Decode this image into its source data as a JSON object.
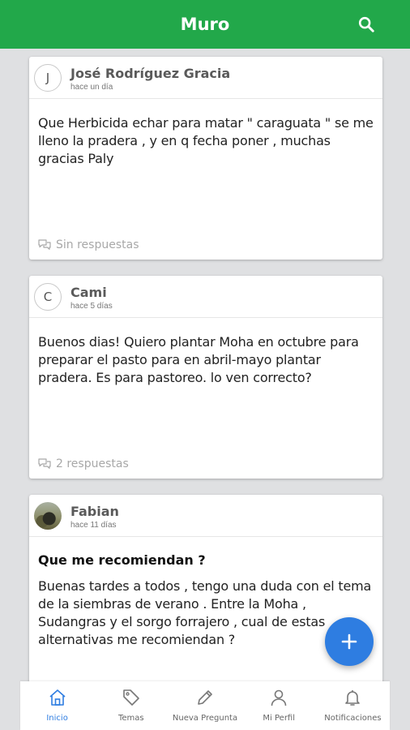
{
  "app_bar": {
    "title": "Muro",
    "search_icon": "search-icon"
  },
  "posts": [
    {
      "avatar_letter": "J",
      "author": "José Rodríguez Gracia",
      "time": "hace un día",
      "title": "",
      "text": "Que Herbicida echar para matar  \" caraguata \" se me lleno la pradera , y en q fecha poner , muchas gracias Paly",
      "replies": "Sin respuestas"
    },
    {
      "avatar_letter": "C",
      "author": "Cami",
      "time": "hace 5 días",
      "title": "",
      "text": "Buenos dias! Quiero plantar Moha en octubre para preparar el pasto para en abril-mayo plantar pradera. Es para pastoreo. lo ven correcto?",
      "replies": "2 respuestas"
    },
    {
      "avatar_letter": "",
      "author": "Fabian",
      "time": "hace 11 días",
      "title": "Que me recomiendan ?",
      "text": "Buenas tardes a todos , tengo una duda con el tema de la siembras de verano . Entre la Moha , Sudangras y el sorgo forrajero , cual de estas alternativas me recomiendan ?",
      "replies": ""
    }
  ],
  "fab": {
    "icon": "plus-icon"
  },
  "bottom_nav": [
    {
      "label": "Inicio",
      "icon": "home-icon",
      "active": true
    },
    {
      "label": "Temas",
      "icon": "tag-icon",
      "active": false
    },
    {
      "label": "Nueva Pregunta",
      "icon": "pencil-icon",
      "active": false
    },
    {
      "label": "Mi Perfil",
      "icon": "user-icon",
      "active": false
    },
    {
      "label": "Notificaciones",
      "icon": "bell-icon",
      "active": false
    }
  ],
  "colors": {
    "app_bar": "#22a84a",
    "accent": "#2e7de1",
    "background": "#dfe0e2"
  }
}
